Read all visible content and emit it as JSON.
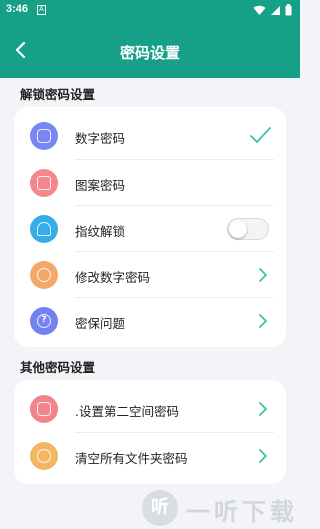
{
  "status_bar": {
    "time": "3:46",
    "notification_icon": "A",
    "icons": [
      "wifi-icon",
      "signal-icon",
      "battery-icon"
    ]
  },
  "app_bar": {
    "title": "密码设置",
    "back_icon": "chevron-left-icon"
  },
  "sections": [
    {
      "title": "解锁密码设置",
      "items": [
        {
          "label": "数字密码",
          "icon": "keypad-icon",
          "icon_color": "#6f7ff3",
          "trailing": "check",
          "selected": true
        },
        {
          "label": "图案密码",
          "icon": "pattern-icon",
          "icon_color": "#f27e83",
          "trailing": "none"
        },
        {
          "label": "指纹解锁",
          "icon": "fingerprint-icon",
          "icon_color": "#2fa8e6",
          "trailing": "toggle",
          "toggle_on": false
        },
        {
          "label": "修改数字密码",
          "icon": "edit-icon",
          "icon_color": "#f2a160",
          "trailing": "chevron"
        },
        {
          "label": "密保问题",
          "icon": "question-icon",
          "icon_color": "#6f7ff3",
          "trailing": "chevron"
        }
      ]
    },
    {
      "title": "其他密码设置",
      "items": [
        {
          "label": ".设置第二空间密码",
          "icon": "second-space-icon",
          "icon_color": "#f07f88",
          "trailing": "chevron"
        },
        {
          "label": "清空所有文件夹密码",
          "icon": "clear-icon",
          "icon_color": "#f2b25a",
          "trailing": "chevron"
        }
      ]
    }
  ],
  "accent_color": "#16a088",
  "watermark": {
    "text": "一听下载",
    "logo": "听"
  }
}
